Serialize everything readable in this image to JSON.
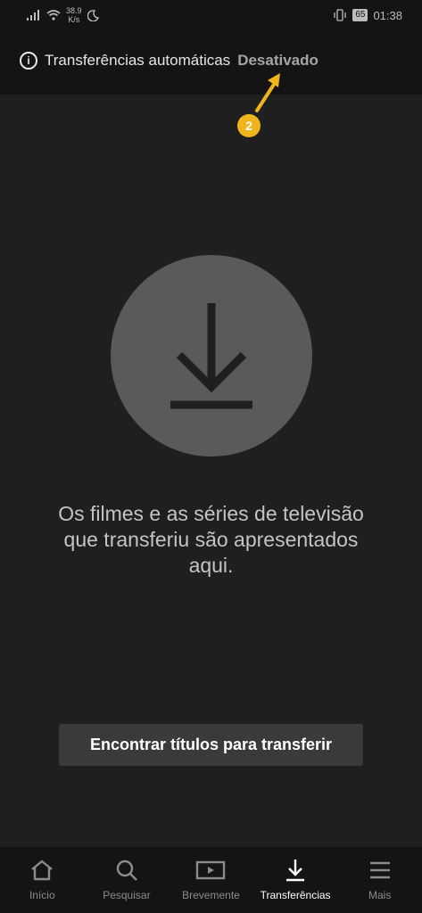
{
  "status_bar": {
    "speed_value": "38.9",
    "speed_unit": "K/s",
    "battery": "65",
    "time": "01:38"
  },
  "header": {
    "auto_label": "Transferências automáticas",
    "auto_status": "Desativado"
  },
  "annotation": {
    "number": "2",
    "color": "#f0b41c"
  },
  "main": {
    "empty_line1": "Os filmes e as séries de televisão",
    "empty_line2": "que transferiu são apresentados",
    "empty_line3": "aqui.",
    "find_button": "Encontrar títulos para transferir"
  },
  "nav": {
    "items": [
      {
        "label": "Início",
        "icon": "home-icon"
      },
      {
        "label": "Pesquisar",
        "icon": "search-icon"
      },
      {
        "label": "Brevemente",
        "icon": "play-icon"
      },
      {
        "label": "Transferências",
        "icon": "download-icon",
        "active": true
      },
      {
        "label": "Mais",
        "icon": "menu-icon"
      }
    ]
  },
  "colors": {
    "background": "#1f1f1f",
    "bars": "#141414",
    "circle": "#5a5a5a",
    "button": "#3a3a3a"
  }
}
